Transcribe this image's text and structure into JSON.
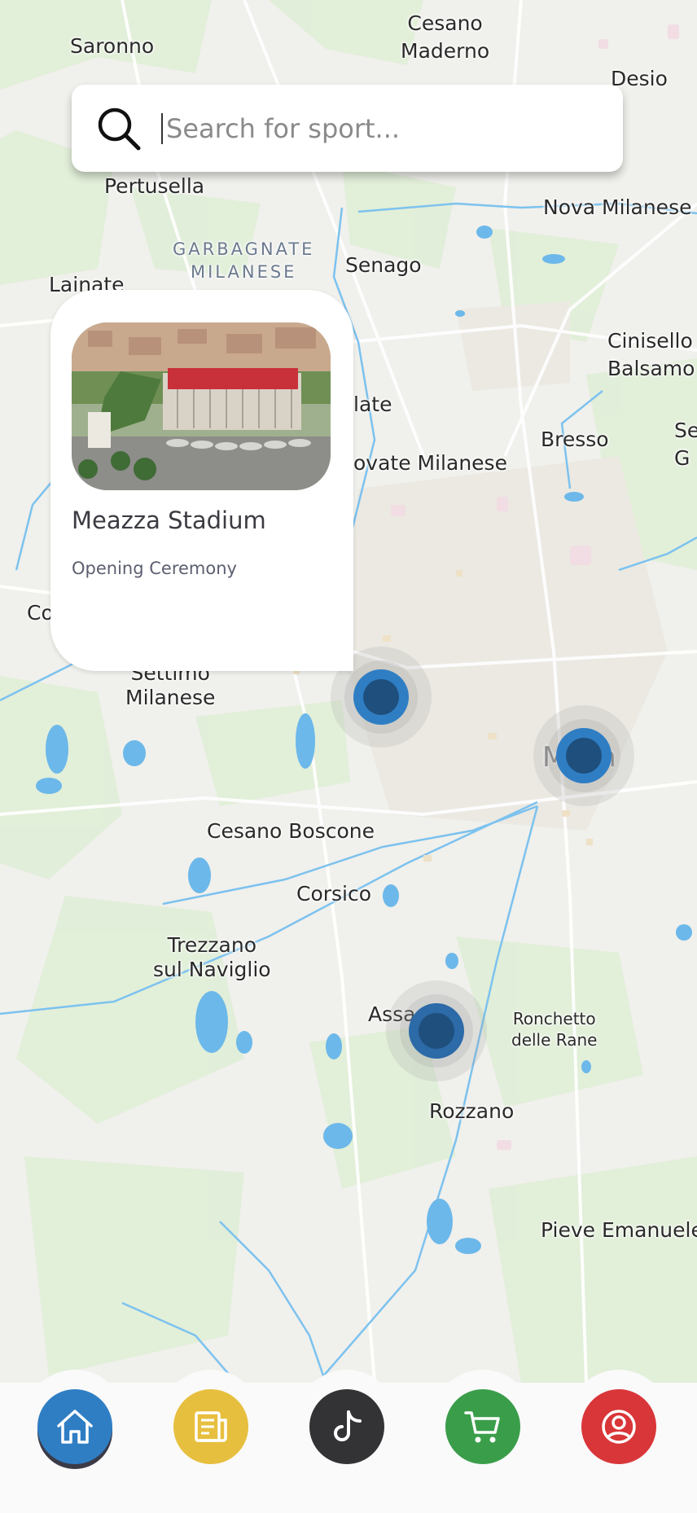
{
  "search": {
    "placeholder": "Search for sport..."
  },
  "map": {
    "places": {
      "saronno": "Saronno",
      "cesano_maderno": "Cesano\nMaderno",
      "desio": "Desio",
      "pertusella": "Pertusella",
      "nova_milanese": "Nova Milanese",
      "garbagnate_milanese": "GARBAGNATE\nMILANESE",
      "senago": "Senago",
      "lainate": "Lainate",
      "cinisello_balsamo": "Cinisello\nBalsamo",
      "bollate": "late",
      "novate_milanese": "ovate Milanese",
      "bresso": "Bresso",
      "sesto": "Se\nG",
      "cornaredo": "Co",
      "settimo_milanese": "Settimo\nMilanese",
      "milano": "Milan",
      "cesano_boscone": "Cesano Boscone",
      "corsico": "Corsico",
      "trezzano": "Trezzano\nsul Naviglio",
      "assago": "Assa",
      "ronchetto": "Ronchetto\ndelle Rane",
      "rozzano": "Rozzano",
      "pieve_emanuele": "Pieve Emanuele"
    },
    "markers": [
      "venue-marker-1",
      "venue-marker-2",
      "venue-marker-3"
    ]
  },
  "venue_card": {
    "name": "Meazza Stadium",
    "event": "Opening Ceremony"
  },
  "nav": {
    "items": [
      {
        "icon": "home-icon",
        "color": "#2f7ec4"
      },
      {
        "icon": "news-icon",
        "color": "#e7bf3f"
      },
      {
        "icon": "tiktok-icon",
        "color": "#333336"
      },
      {
        "icon": "cart-icon",
        "color": "#3a9d4a"
      },
      {
        "icon": "profile-icon",
        "color": "#d9363a"
      }
    ]
  },
  "colors": {
    "map_bg": "#f0f0ec",
    "water": "#6cb8ea",
    "marker_ring": "#2f7ec4",
    "marker_core": "#1f4f7c"
  }
}
